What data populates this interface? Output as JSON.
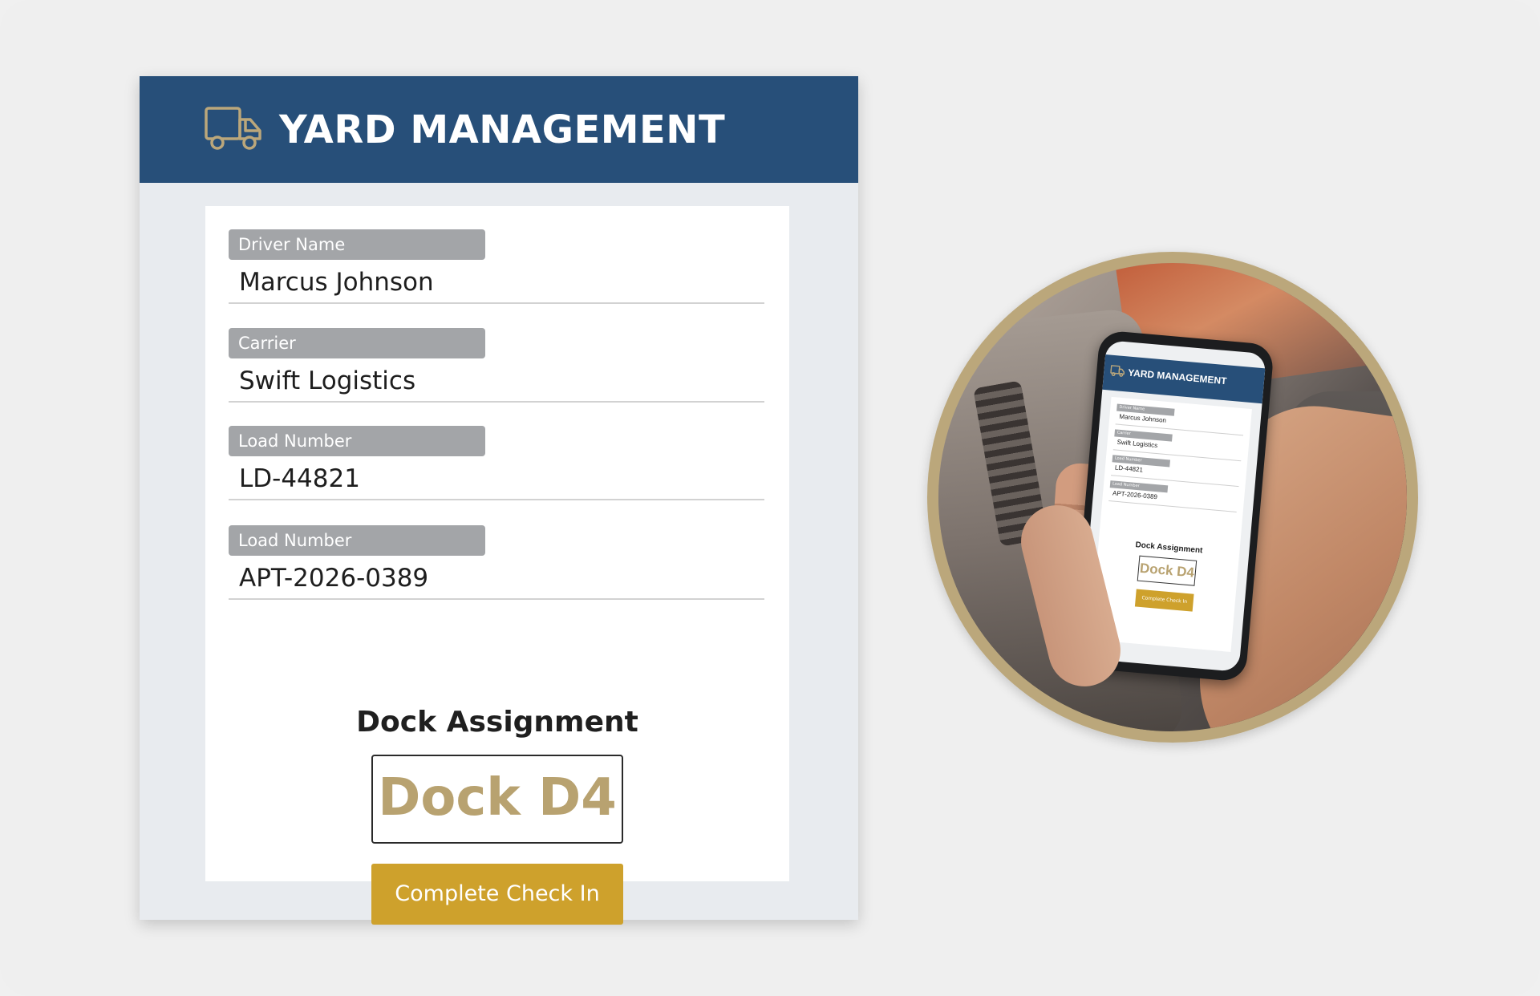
{
  "header": {
    "title": "YARD MANAGEMENT",
    "icon": "truck-icon"
  },
  "form": {
    "fields": [
      {
        "label": "Driver Name",
        "value": "Marcus Johnson"
      },
      {
        "label": "Carrier",
        "value": "Swift Logistics"
      },
      {
        "label": "Load Number",
        "value": "LD-44821"
      },
      {
        "label": "Load Number",
        "value": "APT-2026-0389"
      }
    ]
  },
  "dock": {
    "heading": "Dock Assignment",
    "value": "Dock D4"
  },
  "actions": {
    "check_in_label": "Complete Check In"
  },
  "phone_screen": {
    "title": "YARD MANAGEMENT",
    "fields": [
      {
        "label": "Driver Name",
        "value": "Marcus Johnson"
      },
      {
        "label": "Carrier",
        "value": "Swift Logistics"
      },
      {
        "label": "Load Number",
        "value": "LD-44821"
      },
      {
        "label": "Load Number",
        "value": "APT-2026-0389"
      }
    ],
    "dock_heading": "Dock Assignment",
    "dock_value": "Dock D4",
    "button_label": "Complete Check In"
  },
  "colors": {
    "header_bg": "#274f79",
    "accent_gold": "#cea12c",
    "dock_text": "#b8a270",
    "label_bg": "#a3a5a8",
    "photo_ring": "#bba77b"
  }
}
